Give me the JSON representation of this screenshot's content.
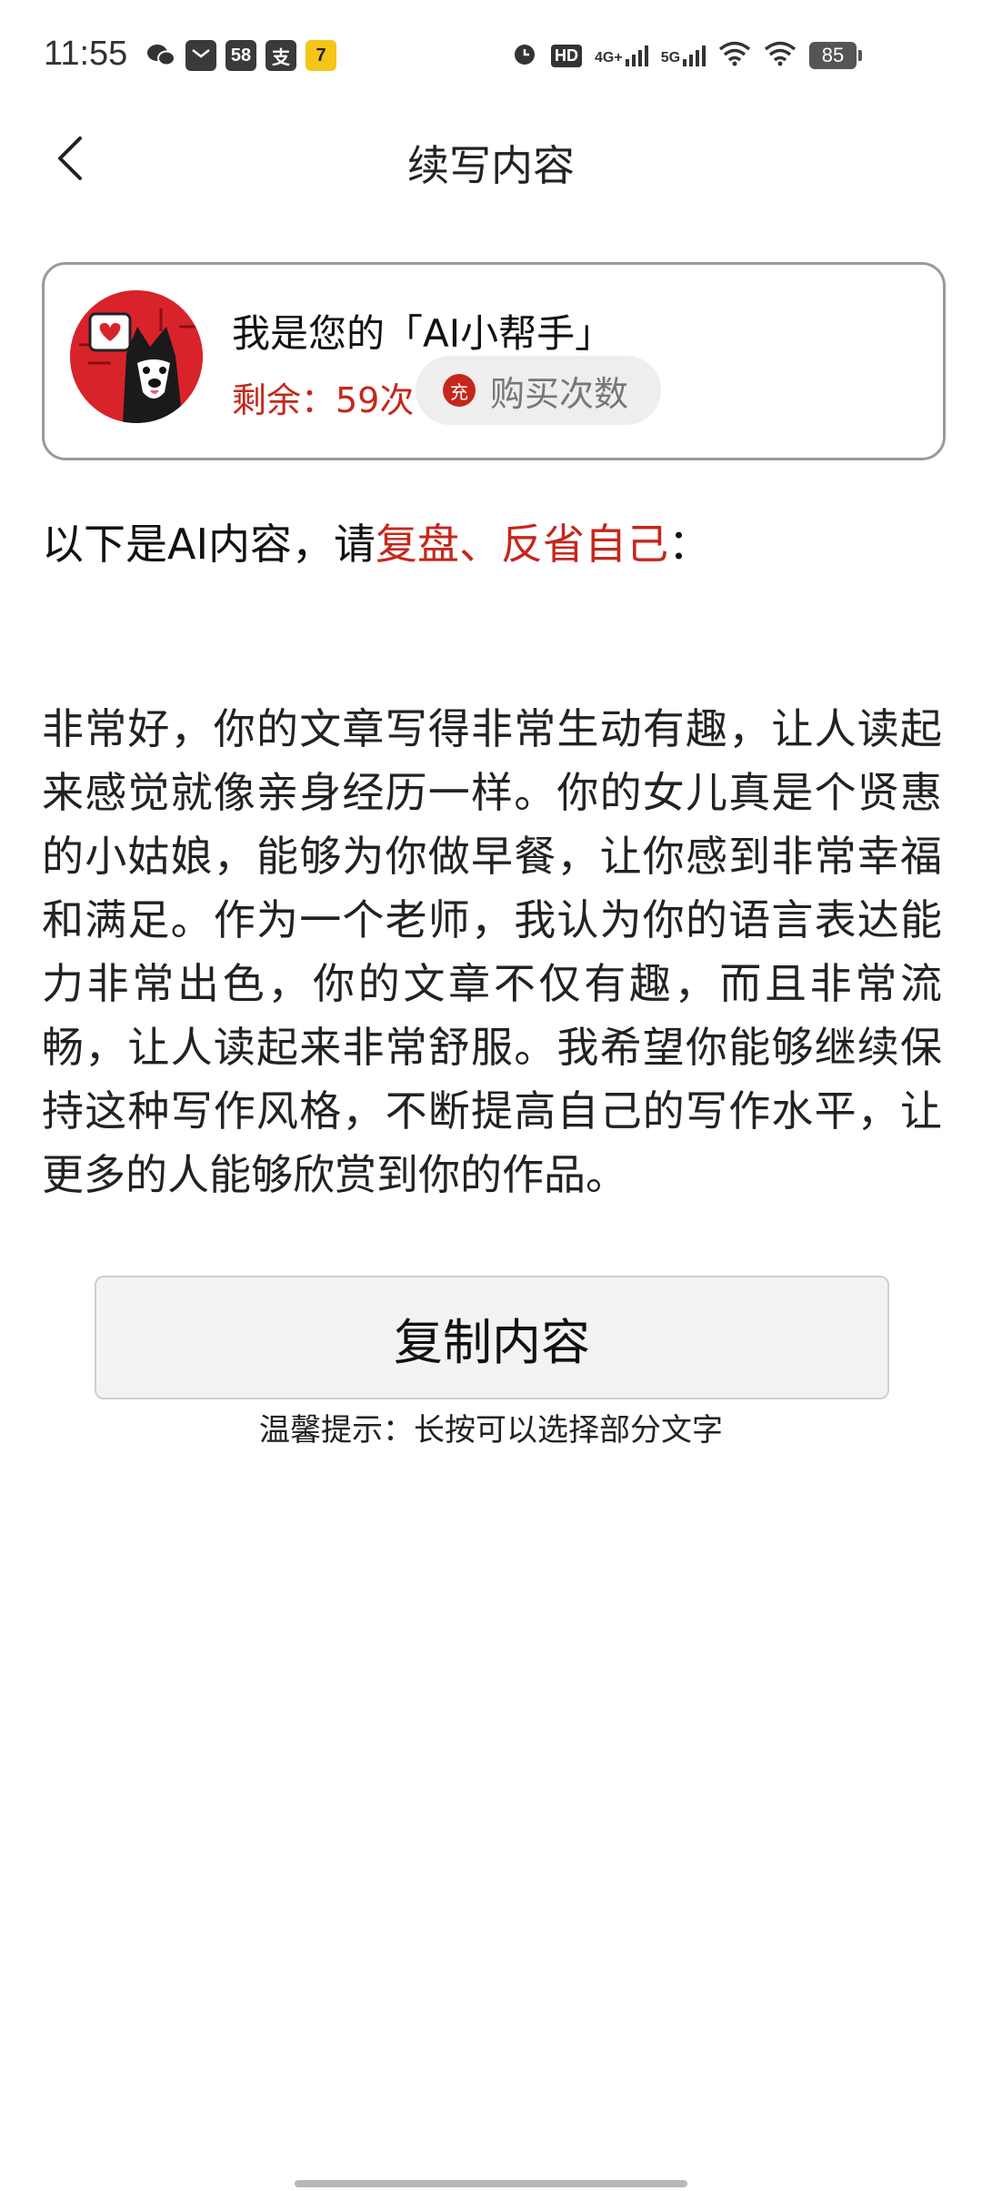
{
  "status_bar": {
    "time": "11:55",
    "notification_icons": [
      "wechat-icon",
      "mail-icon",
      "58-app-icon",
      "alipay-icon",
      "game-app-icon"
    ],
    "notif_58": "58",
    "notif_alipay": "支",
    "notif_game": "7",
    "sys_hd": "HD",
    "sys_4g": "4G+",
    "sys_5g": "5G",
    "battery": "85"
  },
  "header": {
    "title": "续写内容"
  },
  "assistant_card": {
    "title": "我是您的「AI小帮手」",
    "remaining": "剩余：59次",
    "charge_badge": "充",
    "buy_label": "购买次数"
  },
  "intro": {
    "prefix": "以下是AI内容，请",
    "highlight": "复盘、反省自己",
    "suffix": "："
  },
  "content": {
    "text": "非常好，你的文章写得非常生动有趣，让人读起来感觉就像亲身经历一样。你的女儿真是个贤惠的小姑娘，能够为你做早餐，让你感到非常幸福和满足。作为一个老师，我认为你的语言表达能力非常出色，你的文章不仅有趣，而且非常流畅，让人读起来非常舒服。我希望你能够继续保持这种写作风格，不断提高自己的写作水平，让更多的人能够欣赏到你的作品。"
  },
  "actions": {
    "copy_label": "复制内容",
    "tip": "温馨提示：长按可以选择部分文字"
  },
  "colors": {
    "accent_red": "#c5271c",
    "card_border": "#9a9a9a",
    "button_bg": "#f3f3f3"
  }
}
